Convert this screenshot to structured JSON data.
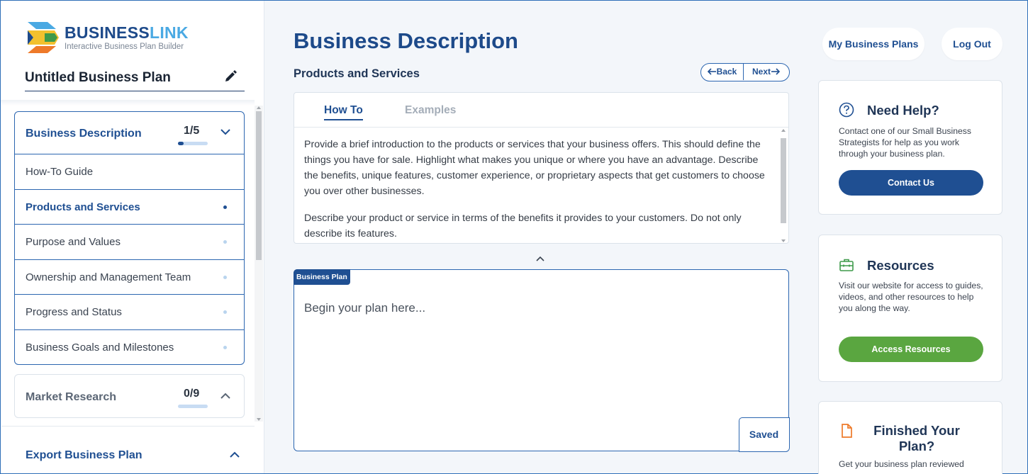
{
  "brand": {
    "name_part1": "BUSINESS",
    "name_part2": "LINK",
    "tagline": "Interactive Business Plan Builder"
  },
  "plan": {
    "name": "Untitled Business Plan"
  },
  "sidebar": {
    "sections": [
      {
        "title": "Business Description",
        "count": "1/5",
        "progress_fraction": 0.2,
        "expanded": true,
        "items": [
          {
            "label": "How-To Guide",
            "active": false
          },
          {
            "label": "Products and Services",
            "active": true
          },
          {
            "label": "Purpose and Values",
            "active": false
          },
          {
            "label": "Ownership and Management Team",
            "active": false
          },
          {
            "label": "Progress and Status",
            "active": false
          },
          {
            "label": "Business Goals and Milestones",
            "active": false
          }
        ]
      },
      {
        "title": "Market Research",
        "count": "0/9",
        "progress_fraction": 0.0,
        "expanded": false
      }
    ],
    "export_label": "Export Business Plan"
  },
  "main": {
    "title": "Business Description",
    "subtitle": "Products and Services",
    "pager": {
      "back": "Back",
      "next": "Next"
    },
    "tabs": [
      {
        "label": "How To",
        "active": true
      },
      {
        "label": "Examples",
        "active": false
      }
    ],
    "howto_paragraphs": [
      "Provide a brief introduction to the products or services that your business offers. This should define the things you have for sale. Highlight what makes you unique or where you have an advantage. Describe the benefits, unique features, customer experience, or proprietary aspects that get customers to choose you over other businesses.",
      "Describe your product or service in terms of the benefits it provides to your customers. Do not only describe its features."
    ],
    "editor": {
      "tag": "Business Plan",
      "placeholder": "Begin your plan here...",
      "value": "",
      "status": "Saved"
    }
  },
  "header_actions": {
    "my_plans": "My Business Plans",
    "logout": "Log Out"
  },
  "help_cards": [
    {
      "icon": "question-circle-icon",
      "title": "Need Help?",
      "text": "Contact one of our Small Business Strategists for help as you work through your business plan.",
      "button": "Contact Us",
      "button_color": "#1f4f92"
    },
    {
      "icon": "toolbox-icon",
      "title": "Resources",
      "text": "Visit our website for access to guides, videos, and other resources to help you along the way.",
      "button": "Access Resources",
      "button_color": "#5aa640"
    },
    {
      "icon": "document-icon",
      "title": "Finished Your Plan?",
      "text": "Get your business plan reviewed"
    }
  ],
  "colors": {
    "primary": "#1f4f92",
    "accent_light": "#4aa9e3",
    "green": "#5aa640",
    "icon_green": "#3e9a4a",
    "icon_orange": "#ee7a2a"
  }
}
